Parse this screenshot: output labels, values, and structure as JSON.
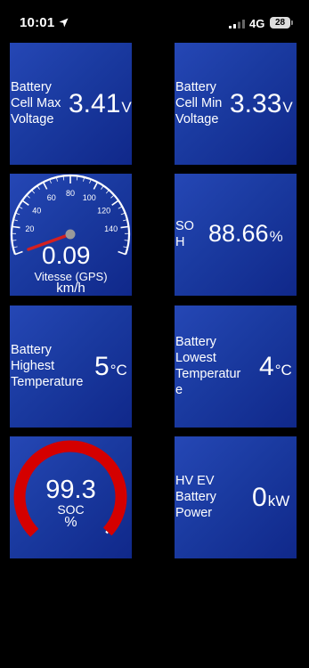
{
  "status_bar": {
    "time": "10:01",
    "location_icon": "location-arrow-icon",
    "signal_icon": "cellular-signal-icon",
    "network": "4G",
    "battery_level": "28"
  },
  "colors": {
    "tile_background": "#1a3aa0",
    "gauge_needle": "#d42020",
    "soc_arc": "#d40000"
  },
  "tiles": {
    "cell_max": {
      "label": "Battery Cell Max Voltage",
      "value": "3.41",
      "unit": "V"
    },
    "cell_min": {
      "label": "Battery Cell Min Voltage",
      "value": "3.33",
      "unit": "V"
    },
    "speed": {
      "value": "0.09",
      "label": "Vitesse (GPS)",
      "unit": "km/h",
      "reading": 0.09,
      "min": 0,
      "max": 160,
      "ticks": [
        "20",
        "40",
        "60",
        "80",
        "100",
        "120",
        "140"
      ]
    },
    "soh": {
      "label": "SO H",
      "value": "88.66",
      "unit": "%"
    },
    "highest_temp": {
      "label": "Battery Highest Temperature",
      "value": "5",
      "unit": "°C"
    },
    "lowest_temp": {
      "label": "Battery Lowest Temperatur e",
      "value": "4",
      "unit": "°C"
    },
    "soc": {
      "value": "99.3",
      "label": "SOC",
      "unit": "%",
      "fraction": 0.993
    },
    "hv_power": {
      "label": "HV EV Battery Power",
      "value": "0",
      "unit": "kW"
    }
  }
}
